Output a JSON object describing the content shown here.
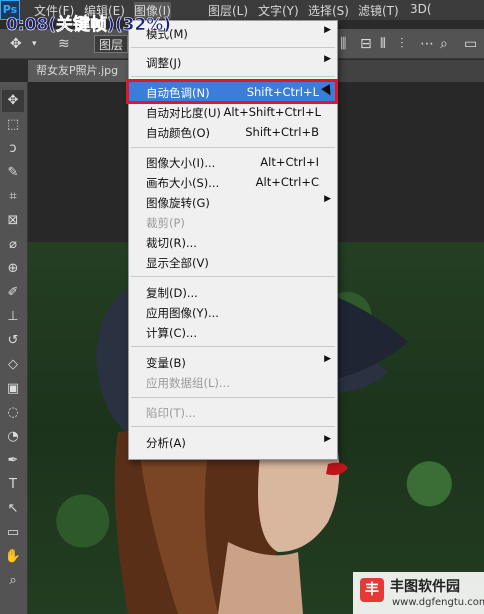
{
  "title_overlay": "0:08(关键帧)(32%)",
  "menubar": {
    "logo": "Ps",
    "items": [
      "文件(F)",
      "编辑(E)",
      "图像(I)",
      "图层(L)",
      "文字(Y)",
      "选择(S)",
      "滤镜(T)",
      "3D("
    ]
  },
  "options_bar": {
    "layer_label": "图层"
  },
  "document_tab": {
    "label": "帮女友P照片.jpg"
  },
  "menu": {
    "items": [
      {
        "label": "模式(M)",
        "shortcut": "",
        "submenu": true,
        "disabled": false
      },
      {
        "label": "调整(J)",
        "shortcut": "",
        "submenu": true,
        "disabled": false
      },
      {
        "label": "自动色调(N)",
        "shortcut": "Shift+Ctrl+L",
        "submenu": false,
        "disabled": false,
        "highlighted": true
      },
      {
        "label": "自动对比度(U)",
        "shortcut": "Alt+Shift+Ctrl+L",
        "submenu": false,
        "disabled": false
      },
      {
        "label": "自动颜色(O)",
        "shortcut": "Shift+Ctrl+B",
        "submenu": false,
        "disabled": false
      },
      {
        "label": "图像大小(I)...",
        "shortcut": "Alt+Ctrl+I",
        "submenu": false,
        "disabled": false
      },
      {
        "label": "画布大小(S)...",
        "shortcut": "Alt+Ctrl+C",
        "submenu": false,
        "disabled": false
      },
      {
        "label": "图像旋转(G)",
        "shortcut": "",
        "submenu": true,
        "disabled": false
      },
      {
        "label": "裁剪(P)",
        "shortcut": "",
        "submenu": false,
        "disabled": true
      },
      {
        "label": "裁切(R)...",
        "shortcut": "",
        "submenu": false,
        "disabled": false
      },
      {
        "label": "显示全部(V)",
        "shortcut": "",
        "submenu": false,
        "disabled": false
      },
      {
        "label": "复制(D)...",
        "shortcut": "",
        "submenu": false,
        "disabled": false
      },
      {
        "label": "应用图像(Y)...",
        "shortcut": "",
        "submenu": false,
        "disabled": false
      },
      {
        "label": "计算(C)...",
        "shortcut": "",
        "submenu": false,
        "disabled": false
      },
      {
        "label": "变量(B)",
        "shortcut": "",
        "submenu": true,
        "disabled": false
      },
      {
        "label": "应用数据组(L)...",
        "shortcut": "",
        "submenu": false,
        "disabled": true
      },
      {
        "label": "陷印(T)...",
        "shortcut": "",
        "submenu": false,
        "disabled": true
      },
      {
        "label": "分析(A)",
        "shortcut": "",
        "submenu": true,
        "disabled": false
      }
    ]
  },
  "watermark": {
    "logo": "丰",
    "title": "丰图软件园",
    "url": "www.dgfengtu.com"
  },
  "colors": {
    "highlight": "#3b7dd8",
    "callout_border": "#e0162b",
    "menu_bg": "#f0f0f0"
  }
}
